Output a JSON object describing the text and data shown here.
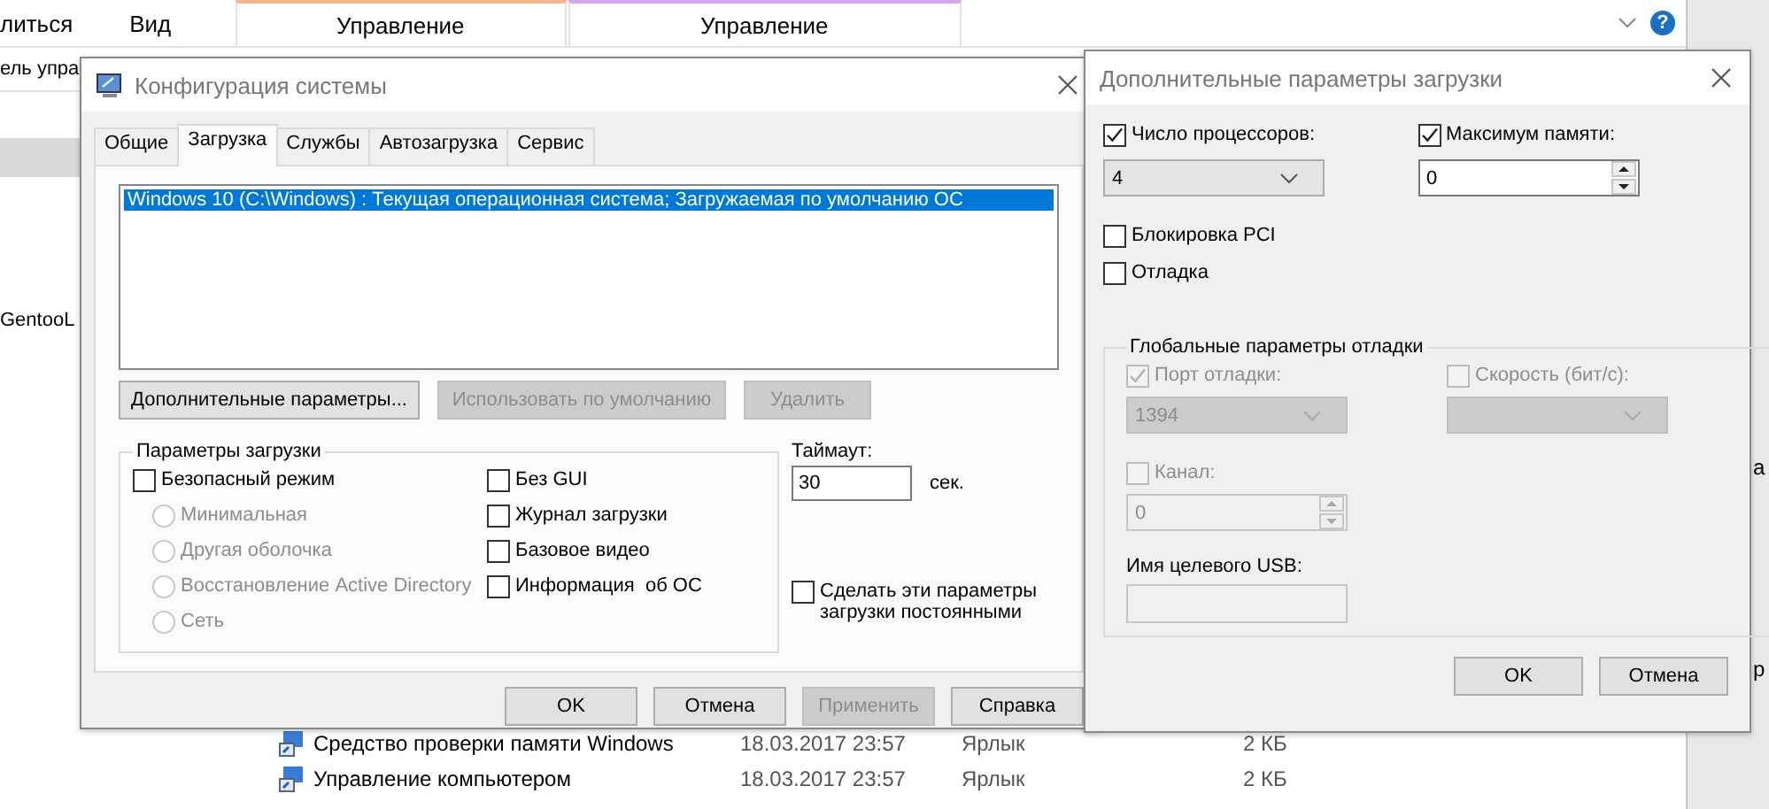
{
  "explorer": {
    "ribbon_tabs": [
      {
        "label": "литься",
        "kind": "plain"
      },
      {
        "label": "Вид",
        "kind": "plain"
      },
      {
        "label": "Управление",
        "kind": "context",
        "color": "#f5b78e"
      },
      {
        "label": "Управление",
        "kind": "context",
        "color": "#d6a8f0"
      }
    ],
    "help": "?",
    "address": "ель упра",
    "nav_item": "GentooL",
    "files": [
      {
        "name": "Средство проверки памяти Windows",
        "date": "18.03.2017 23:57",
        "type": "Ярлык",
        "size": "2 КБ"
      },
      {
        "name": "Управление компьютером",
        "date": "18.03.2017 23:57",
        "type": "Ярлык",
        "size": "2 КБ"
      }
    ],
    "side_fragments": [
      "а",
      "р"
    ]
  },
  "msconfig": {
    "title": "Конфигурация системы",
    "tabs": [
      {
        "label": "Общие",
        "selected": false
      },
      {
        "label": "Загрузка",
        "selected": true
      },
      {
        "label": "Службы",
        "selected": false
      },
      {
        "label": "Автозагрузка",
        "selected": false
      },
      {
        "label": "Сервис",
        "selected": false
      }
    ],
    "boot_entries": [
      {
        "label": "Windows 10 (C:\\Windows) : Текущая операционная система; Загружаемая по умолчанию ОС",
        "selected": true
      }
    ],
    "entry_buttons": [
      {
        "label": "Дополнительные параметры...",
        "disabled": false
      },
      {
        "label": "Использовать по умолчанию",
        "disabled": true
      },
      {
        "label": "Удалить",
        "disabled": true
      }
    ],
    "boot_options": {
      "title": "Параметры загрузки",
      "safe_mode": {
        "label": "Безопасный режим",
        "checked": false
      },
      "safe_mode_types": [
        {
          "label": "Минимальная",
          "selected": false,
          "disabled": true
        },
        {
          "label": "Другая оболочка",
          "selected": false,
          "disabled": true
        },
        {
          "label": "Восстановление Active Directory",
          "selected": false,
          "disabled": true
        },
        {
          "label": "Сеть",
          "selected": false,
          "disabled": true
        }
      ],
      "flags": [
        {
          "label": "Без GUI",
          "checked": false
        },
        {
          "label": "Журнал загрузки",
          "checked": false
        },
        {
          "label": "Базовое видео",
          "checked": false
        },
        {
          "label": "Информация  об ОС",
          "checked": false
        }
      ]
    },
    "timeout": {
      "label": "Таймаут:",
      "value": "30",
      "unit": "сек."
    },
    "make_permanent": {
      "label": "Сделать эти параметры загрузки постоянными",
      "checked": false
    },
    "buttons": [
      {
        "label": "OK",
        "disabled": false
      },
      {
        "label": "Отмена",
        "disabled": false
      },
      {
        "label": "Применить",
        "disabled": true
      },
      {
        "label": "Справка",
        "disabled": false
      }
    ]
  },
  "advanced": {
    "title": "Дополнительные параметры загрузки",
    "processors": {
      "label": "Число процессоров:",
      "checked": true,
      "value": "4"
    },
    "max_memory": {
      "label": "Максимум памяти:",
      "checked": true,
      "value": "0"
    },
    "pci_lock": {
      "label": "Блокировка PCI",
      "checked": false
    },
    "debug": {
      "label": "Отладка",
      "checked": false
    },
    "debug_settings": {
      "title": "Глобальные параметры отладки",
      "disabled": true,
      "port": {
        "label": "Порт отладки:",
        "checked": true,
        "value": "1394"
      },
      "baud": {
        "label": "Скорость (бит/с):",
        "checked": false
      },
      "channel": {
        "label": "Канал:",
        "checked": false,
        "value": "0"
      },
      "usb_target": {
        "label": "Имя целевого USB:"
      }
    },
    "buttons": [
      {
        "label": "OK",
        "disabled": false
      },
      {
        "label": "Отмена",
        "disabled": false
      }
    ]
  }
}
